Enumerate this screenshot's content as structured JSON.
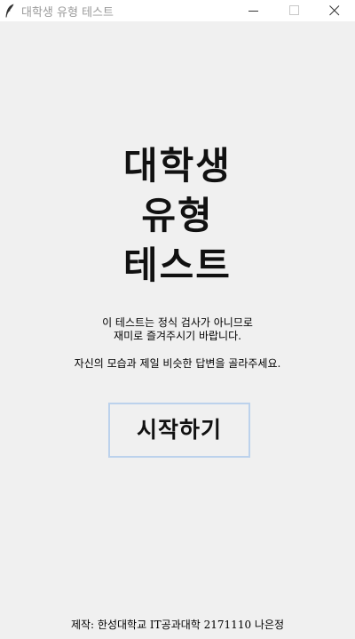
{
  "window": {
    "title": "대학생 유형 테스트",
    "icon": "feather-icon"
  },
  "main": {
    "title_lines": [
      "대학생",
      "유형",
      "테스트"
    ],
    "notice_lines": [
      "이 테스트는 정식 검사가 아니므로",
      "재미로 즐겨주시기 바랍니다."
    ],
    "instruction": "자신의 모습과 제일 비슷한 답변을 골라주세요.",
    "start_label": "시작하기"
  },
  "footer": {
    "credit": "제작: 한성대학교 IT공과대학 2171110 나은정"
  },
  "colors": {
    "background": "#f0f0f0",
    "button_border": "#bcd2ec",
    "title_text": "#9a9a9a"
  }
}
